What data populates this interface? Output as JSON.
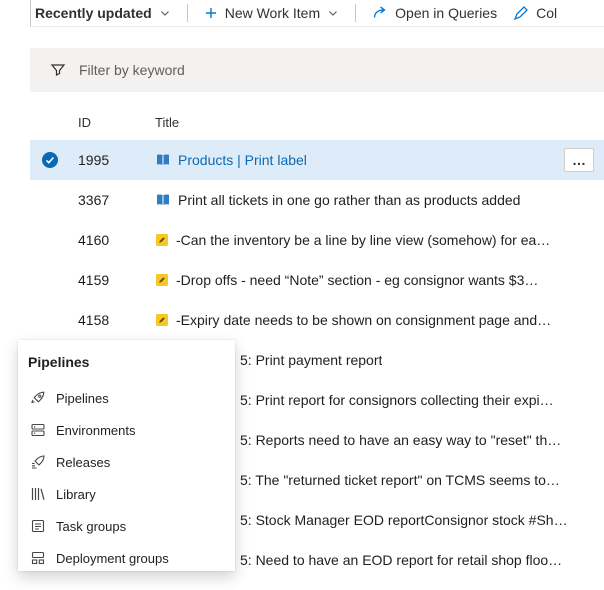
{
  "toolbar": {
    "view_selector_label": "Recently updated",
    "new_work_item_label": "New Work Item",
    "open_in_queries_label": "Open in Queries",
    "column_options_label": "Col"
  },
  "filter": {
    "placeholder": "Filter by keyword"
  },
  "table": {
    "columns": {
      "id": "ID",
      "title": "Title"
    },
    "rows": [
      {
        "id": "1995",
        "title": "Products | Print label"
      },
      {
        "id": "3367",
        "title": "Print all tickets in one go rather than as products added"
      },
      {
        "id": "4160",
        "title": "-Can the inventory be a line by line view (somehow) for ea…"
      },
      {
        "id": "4159",
        "title": "-Drop offs - need “Note” section - eg consignor wants $3…"
      },
      {
        "id": "4158",
        "title": "-Expiry date needs to be shown on consignment page and…"
      }
    ],
    "partial_rows": [
      {
        "title": "5: Print payment report"
      },
      {
        "title": "5: Print report for consignors collecting their expi…"
      },
      {
        "title": "5: Reports need to have an easy way to \"reset\" th…"
      },
      {
        "title": "5: The \"returned ticket report\" on TCMS seems to…"
      },
      {
        "title": "5: Stock Manager EOD reportConsignor stock #Sh…"
      },
      {
        "title": "5: Need to have an EOD report for retail shop floo…"
      }
    ]
  },
  "flyout": {
    "title": "Pipelines",
    "items": [
      {
        "label": "Pipelines"
      },
      {
        "label": "Environments"
      },
      {
        "label": "Releases"
      },
      {
        "label": "Library"
      },
      {
        "label": "Task groups"
      },
      {
        "label": "Deployment groups"
      }
    ]
  },
  "icons": {
    "more": "…"
  },
  "colors": {
    "accent": "#0078d4",
    "selected_row_bg": "#deecf9",
    "issue_icon_yellow": "#f8c725",
    "book_icon_blue": "#2f7cc4",
    "filter_bar_bg": "#f3f2f1"
  }
}
